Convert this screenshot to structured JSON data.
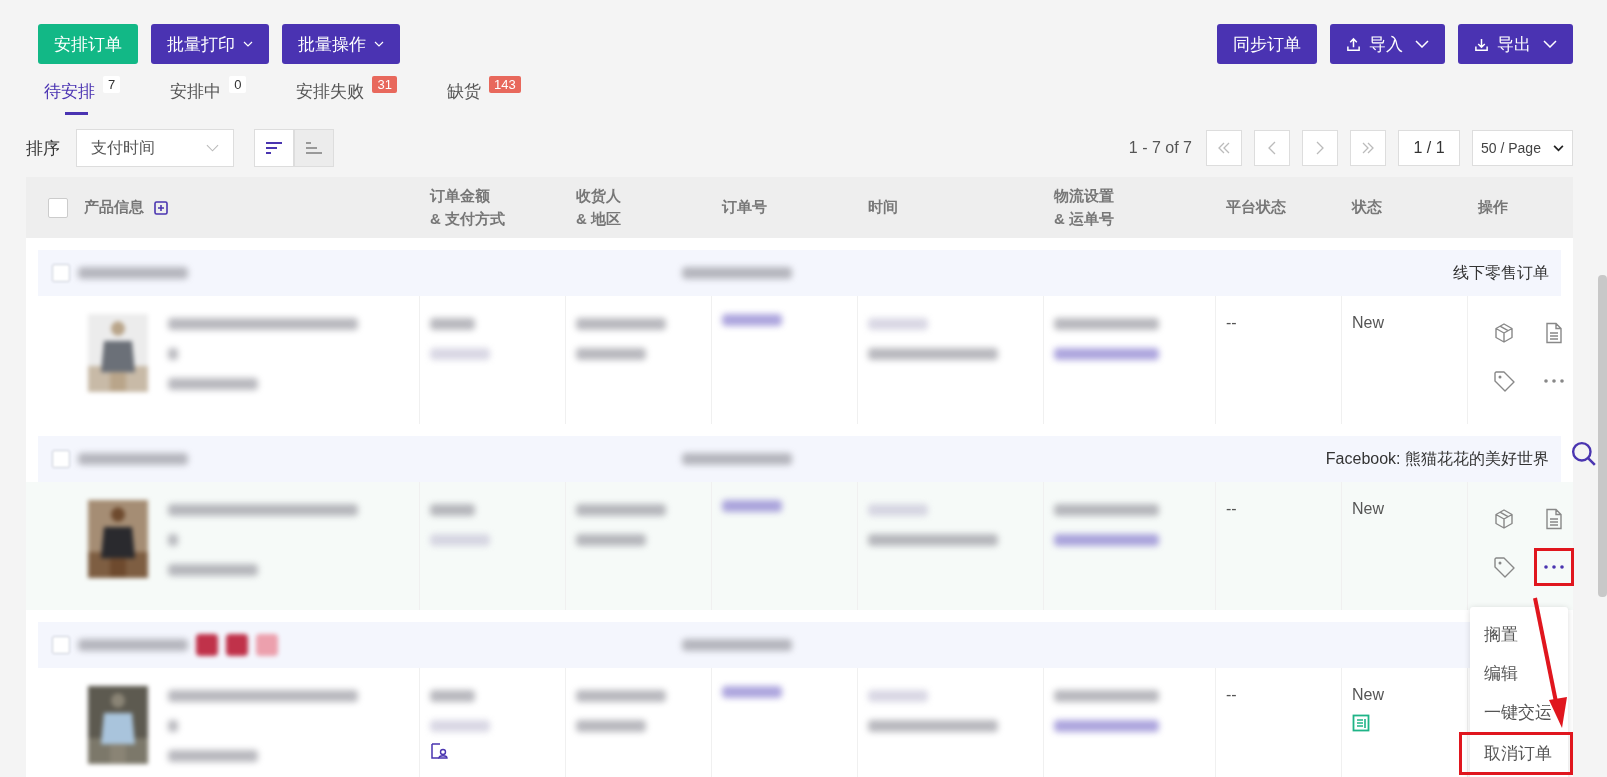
{
  "toolbar": {
    "left": [
      {
        "label": "安排订单",
        "kind": "primary"
      },
      {
        "label": "批量打印",
        "kind": "dropdown"
      },
      {
        "label": "批量操作",
        "kind": "dropdown"
      }
    ],
    "right": [
      {
        "label": "同步订单",
        "kind": "plain"
      },
      {
        "label": "导入",
        "kind": "import"
      },
      {
        "label": "导出",
        "kind": "export"
      }
    ]
  },
  "tabs": [
    {
      "label": "待安排",
      "count": "7",
      "kind": "plain",
      "selected": true
    },
    {
      "label": "安排中",
      "count": "0",
      "kind": "plain",
      "selected": false
    },
    {
      "label": "安排失败",
      "count": "31",
      "kind": "alert",
      "selected": false
    },
    {
      "label": "缺货",
      "count": "143",
      "kind": "alert",
      "selected": false
    }
  ],
  "sort": {
    "label": "排序",
    "value": "支付时间",
    "orders": [
      {
        "kind": "desc",
        "selected": true
      },
      {
        "kind": "asc",
        "selected": false
      }
    ]
  },
  "pagination": {
    "range": "1 - 7 of 7",
    "page": "1 / 1",
    "page_size": "50 / Page"
  },
  "table": {
    "select_all_checked": false,
    "columns": [
      {
        "label": "产品信息",
        "add": true
      },
      {
        "label": "订单金额",
        "sublabel": "& 支付方式"
      },
      {
        "label": "收货人",
        "sublabel": "& 地区"
      },
      {
        "label": "订单号"
      },
      {
        "label": "时间"
      },
      {
        "label": "物流设置",
        "sublabel": "& 运单号"
      },
      {
        "label": "平台状态"
      },
      {
        "label": "状态"
      },
      {
        "label": "操作"
      }
    ],
    "orders": [
      {
        "store": "线下零售订单",
        "platform_status": "--",
        "status": "New",
        "hovered": false,
        "flagged": false,
        "doc_icon": false,
        "note_icon": false,
        "show_actions": true,
        "more_highlighted": false
      },
      {
        "store": "Facebook: 熊猫花花的美好世界",
        "platform_status": "--",
        "status": "New",
        "hovered": true,
        "flagged": false,
        "doc_icon": false,
        "note_icon": false,
        "show_actions": true,
        "more_highlighted": true
      },
      {
        "platform_status": "--",
        "status": "New",
        "hovered": false,
        "flagged": true,
        "doc_icon": true,
        "note_icon": true,
        "show_actions": false
      }
    ]
  },
  "action_menu": {
    "items": [
      {
        "label": "搁置",
        "highlighted": false
      },
      {
        "label": "编辑",
        "highlighted": false
      },
      {
        "label": "一键交运",
        "highlighted": false
      },
      {
        "label": "取消订单",
        "highlighted": true
      }
    ]
  }
}
